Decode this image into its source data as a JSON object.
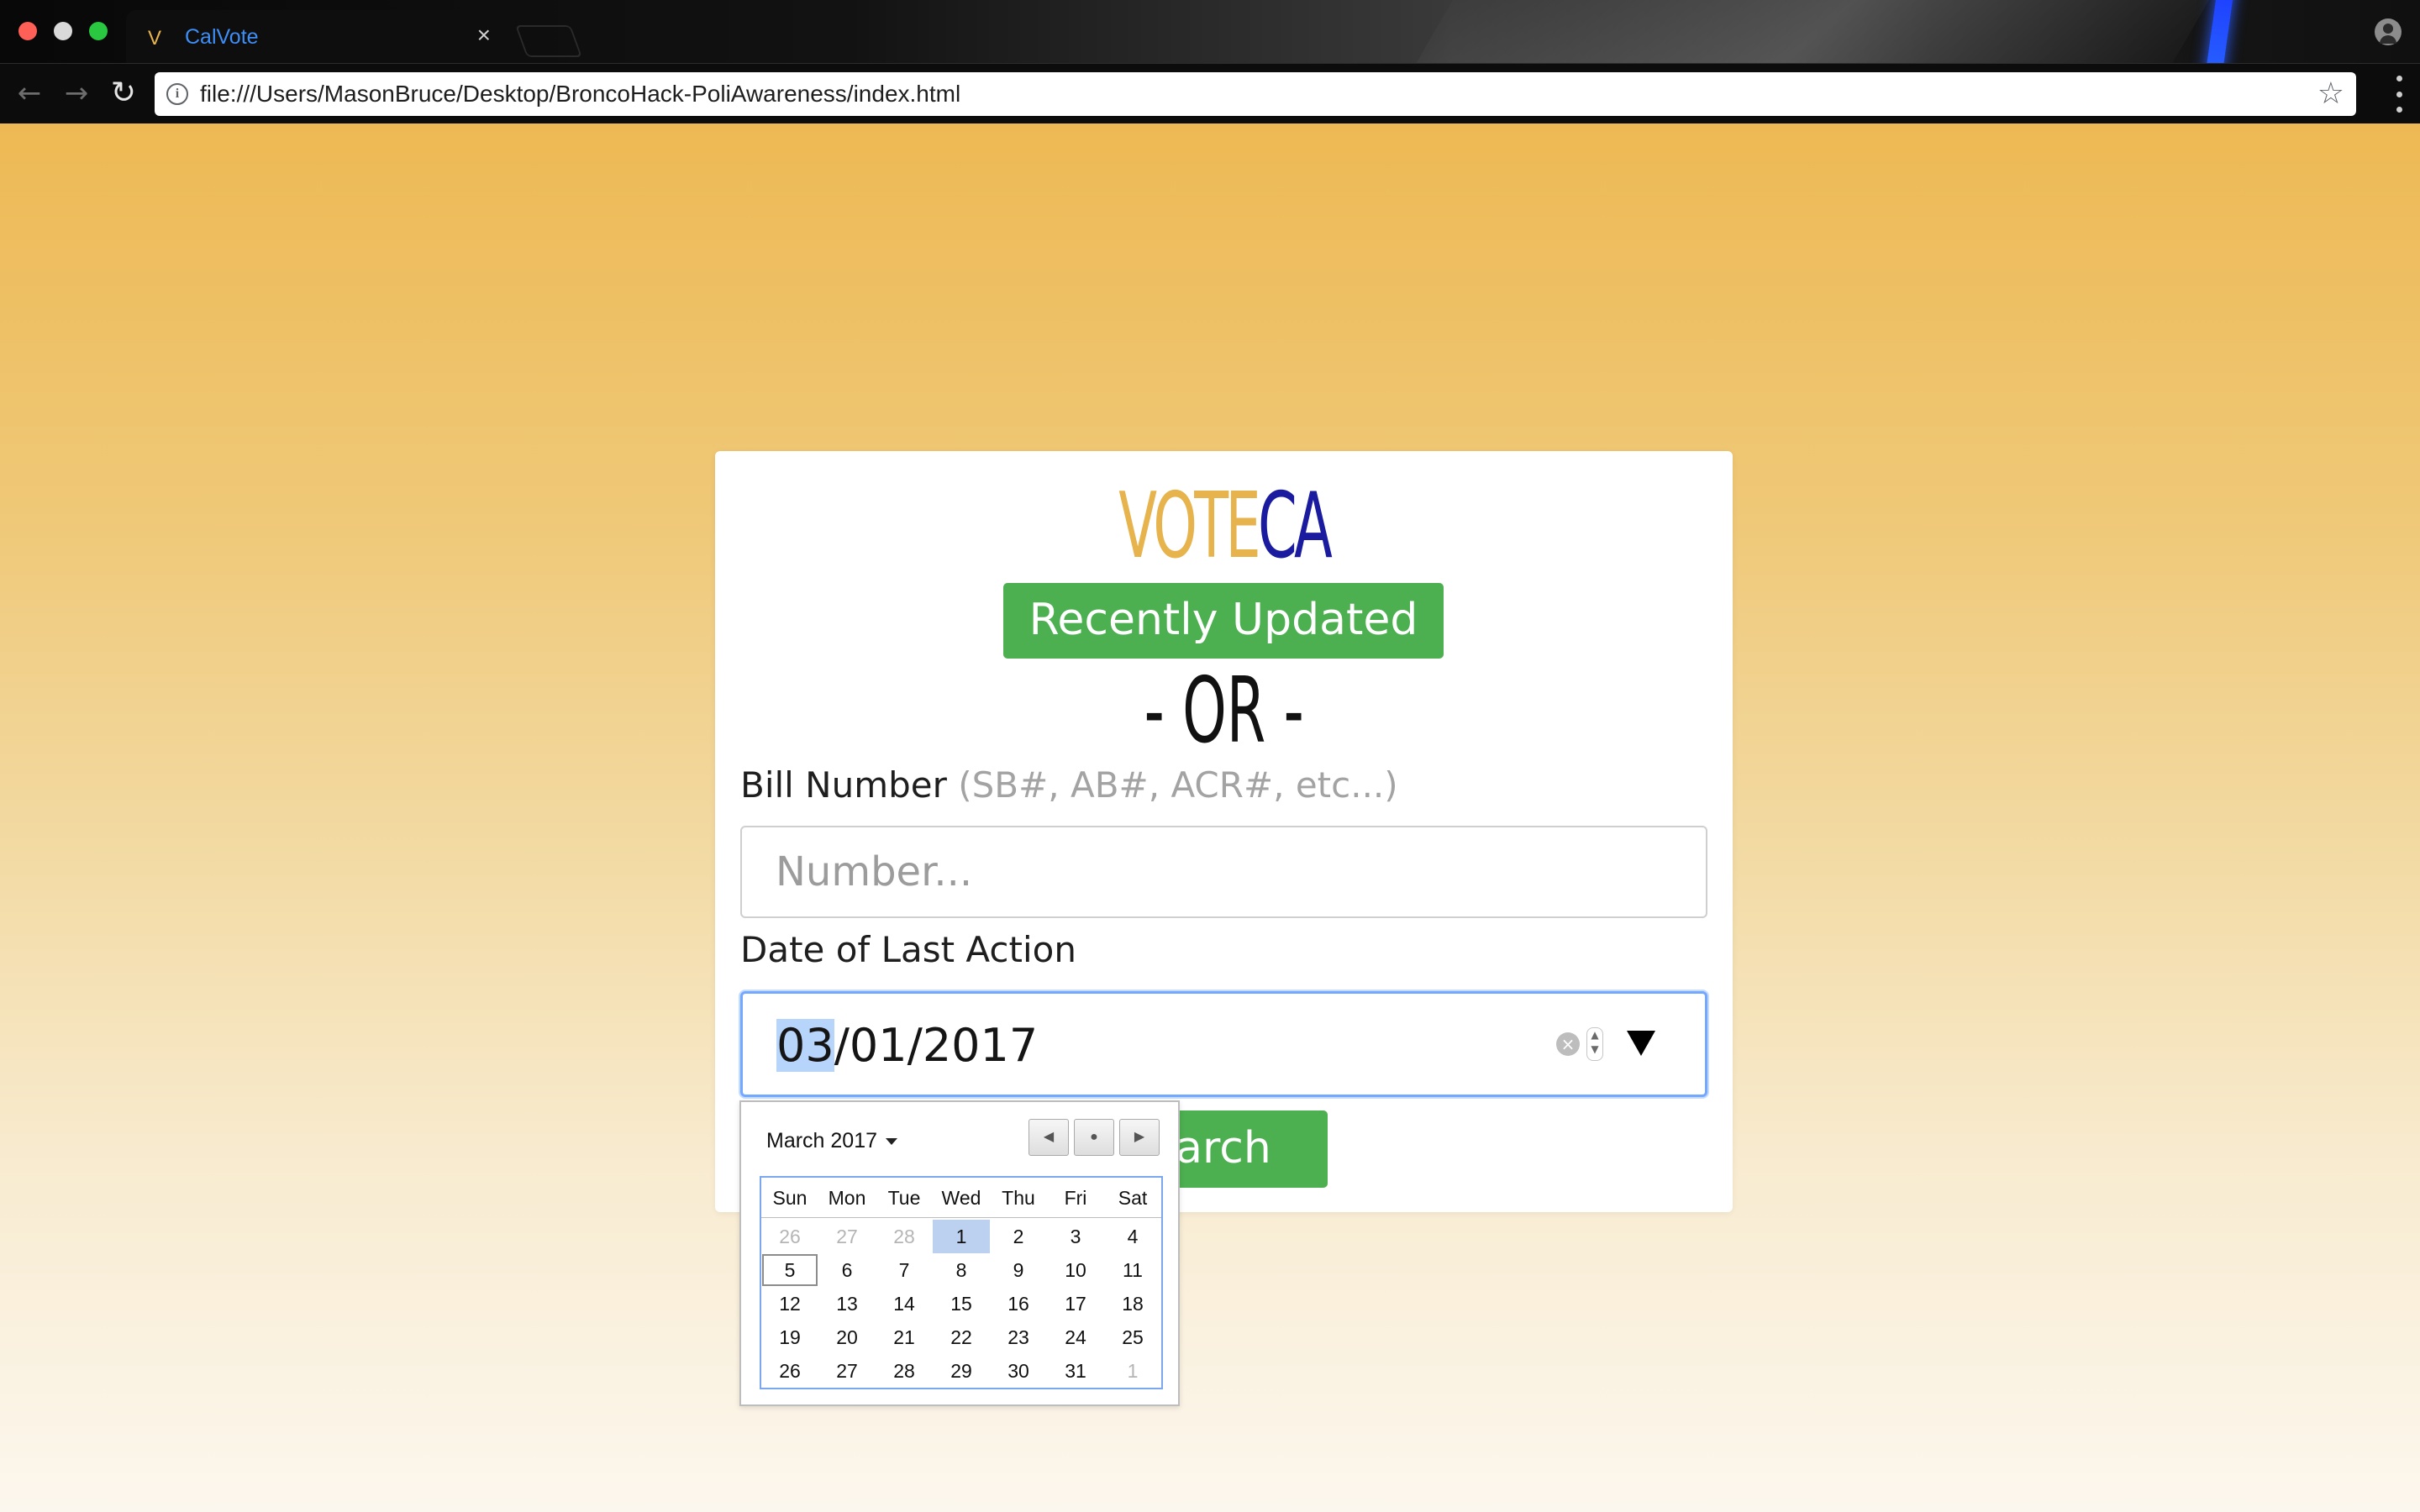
{
  "browser": {
    "tab_title": "CalVote",
    "tab_favicon": "V",
    "tab_close": "×",
    "url": "file:///Users/MasonBruce/Desktop/BroncoHack-PoliAwareness/index.html",
    "icons": [
      "back-arrow-icon",
      "forward-arrow-icon",
      "reload-icon",
      "info-icon",
      "star-icon",
      "menu-icon",
      "profile-icon"
    ]
  },
  "page": {
    "logo_part1": "VOTE",
    "logo_part2": "CA",
    "logo_colors": {
      "part1": "#e6b34c",
      "part2": "#1a1b9e"
    },
    "recently_updated_label": "Recently Updated",
    "or_text": "- OR -",
    "bill_label": "Bill Number",
    "bill_hint": "(SB#, AB#, ACR#, etc...)",
    "bill_placeholder": "Number...",
    "date_label": "Date of Last Action",
    "date_value_selected": "03",
    "date_value_rest": "/01/2017",
    "search_label": "Search",
    "search_visible": "earch",
    "accent_color": "#4caf50"
  },
  "calendar": {
    "month_label": "March 2017",
    "weekdays": [
      "Sun",
      "Mon",
      "Tue",
      "Wed",
      "Thu",
      "Fri",
      "Sat"
    ],
    "weeks": [
      [
        {
          "d": "26",
          "dim": true
        },
        {
          "d": "27",
          "dim": true
        },
        {
          "d": "28",
          "dim": true
        },
        {
          "d": "1",
          "sel": true
        },
        {
          "d": "2"
        },
        {
          "d": "3"
        },
        {
          "d": "4"
        }
      ],
      [
        {
          "d": "5",
          "today": true
        },
        {
          "d": "6"
        },
        {
          "d": "7"
        },
        {
          "d": "8"
        },
        {
          "d": "9"
        },
        {
          "d": "10"
        },
        {
          "d": "11"
        }
      ],
      [
        {
          "d": "12"
        },
        {
          "d": "13"
        },
        {
          "d": "14"
        },
        {
          "d": "15"
        },
        {
          "d": "16"
        },
        {
          "d": "17"
        },
        {
          "d": "18"
        }
      ],
      [
        {
          "d": "19"
        },
        {
          "d": "20"
        },
        {
          "d": "21"
        },
        {
          "d": "22"
        },
        {
          "d": "23"
        },
        {
          "d": "24"
        },
        {
          "d": "25"
        }
      ],
      [
        {
          "d": "26"
        },
        {
          "d": "27"
        },
        {
          "d": "28"
        },
        {
          "d": "29"
        },
        {
          "d": "30"
        },
        {
          "d": "31"
        },
        {
          "d": "1",
          "dim": true
        }
      ]
    ],
    "selected_day": "1",
    "today_day": "5"
  }
}
